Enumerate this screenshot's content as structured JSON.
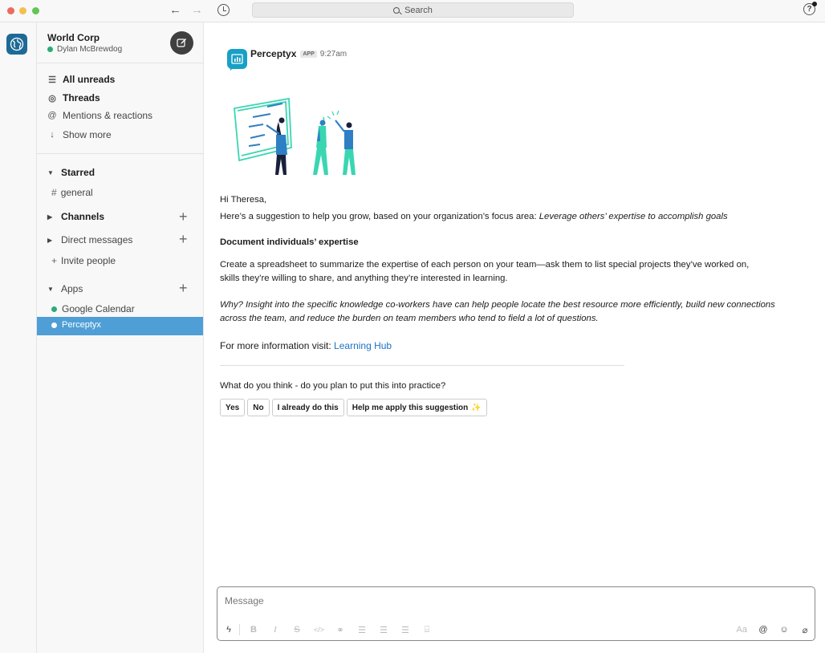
{
  "titlebar": {
    "search_placeholder": "Search",
    "help": "?"
  },
  "workspace": {
    "name": "World Corp",
    "user": "Dylan McBrewdog"
  },
  "sidebar": {
    "nav": [
      {
        "label": "All unreads",
        "icon": "list-icon"
      },
      {
        "label": "Threads",
        "icon": "threads-icon"
      },
      {
        "label": "Mentions & reactions",
        "icon": "at-icon"
      },
      {
        "label": "Show more",
        "icon": "arrow-down-icon"
      }
    ],
    "starred": "Starred",
    "general": "general",
    "channels": "Channels",
    "direct_messages": "Direct messages",
    "invite": "Invite people",
    "apps": "Apps",
    "google_calendar": "Google Calendar",
    "perceptyx": "Perceptyx"
  },
  "message": {
    "sender": "Perceptyx",
    "badge": "APP",
    "time": "9:27am",
    "greeting": "Hi Theresa,",
    "intro": "Here’s a suggestion to help you grow, based on your organization’s focus area: ",
    "focus_area": "Leverage others’ expertise to accomplish goals",
    "heading": "Document individuals’ expertise",
    "body_line1": "Create a spreadsheet to summarize the expertise of each person on your team—ask them to list special projects they’ve worked on,",
    "body_line2": "skills they’re willing to share, and anything they’re interested in learning.",
    "why_line1": "Why? Insight into the specific knowledge co-workers have can help people locate the best resource more efficiently, build new connections",
    "why_line2": "across the team, and reduce the burden on team members who tend to field a lot of questions.",
    "more_info": "For more information visit: ",
    "link": "Learning Hub",
    "question": "What do you think - do you plan to put this into practice?",
    "buttons": [
      "Yes",
      "No",
      "I already do this",
      "Help me apply this suggestion"
    ]
  },
  "composer": {
    "placeholder": "Message",
    "format_label": "Aa",
    "at": "@"
  },
  "colors": {
    "accent": "#4f9fd6",
    "presence": "#2bac76",
    "link": "#1d72c6",
    "illustration_teal": "#3ad6b2",
    "illustration_blue": "#2f7fc4"
  }
}
